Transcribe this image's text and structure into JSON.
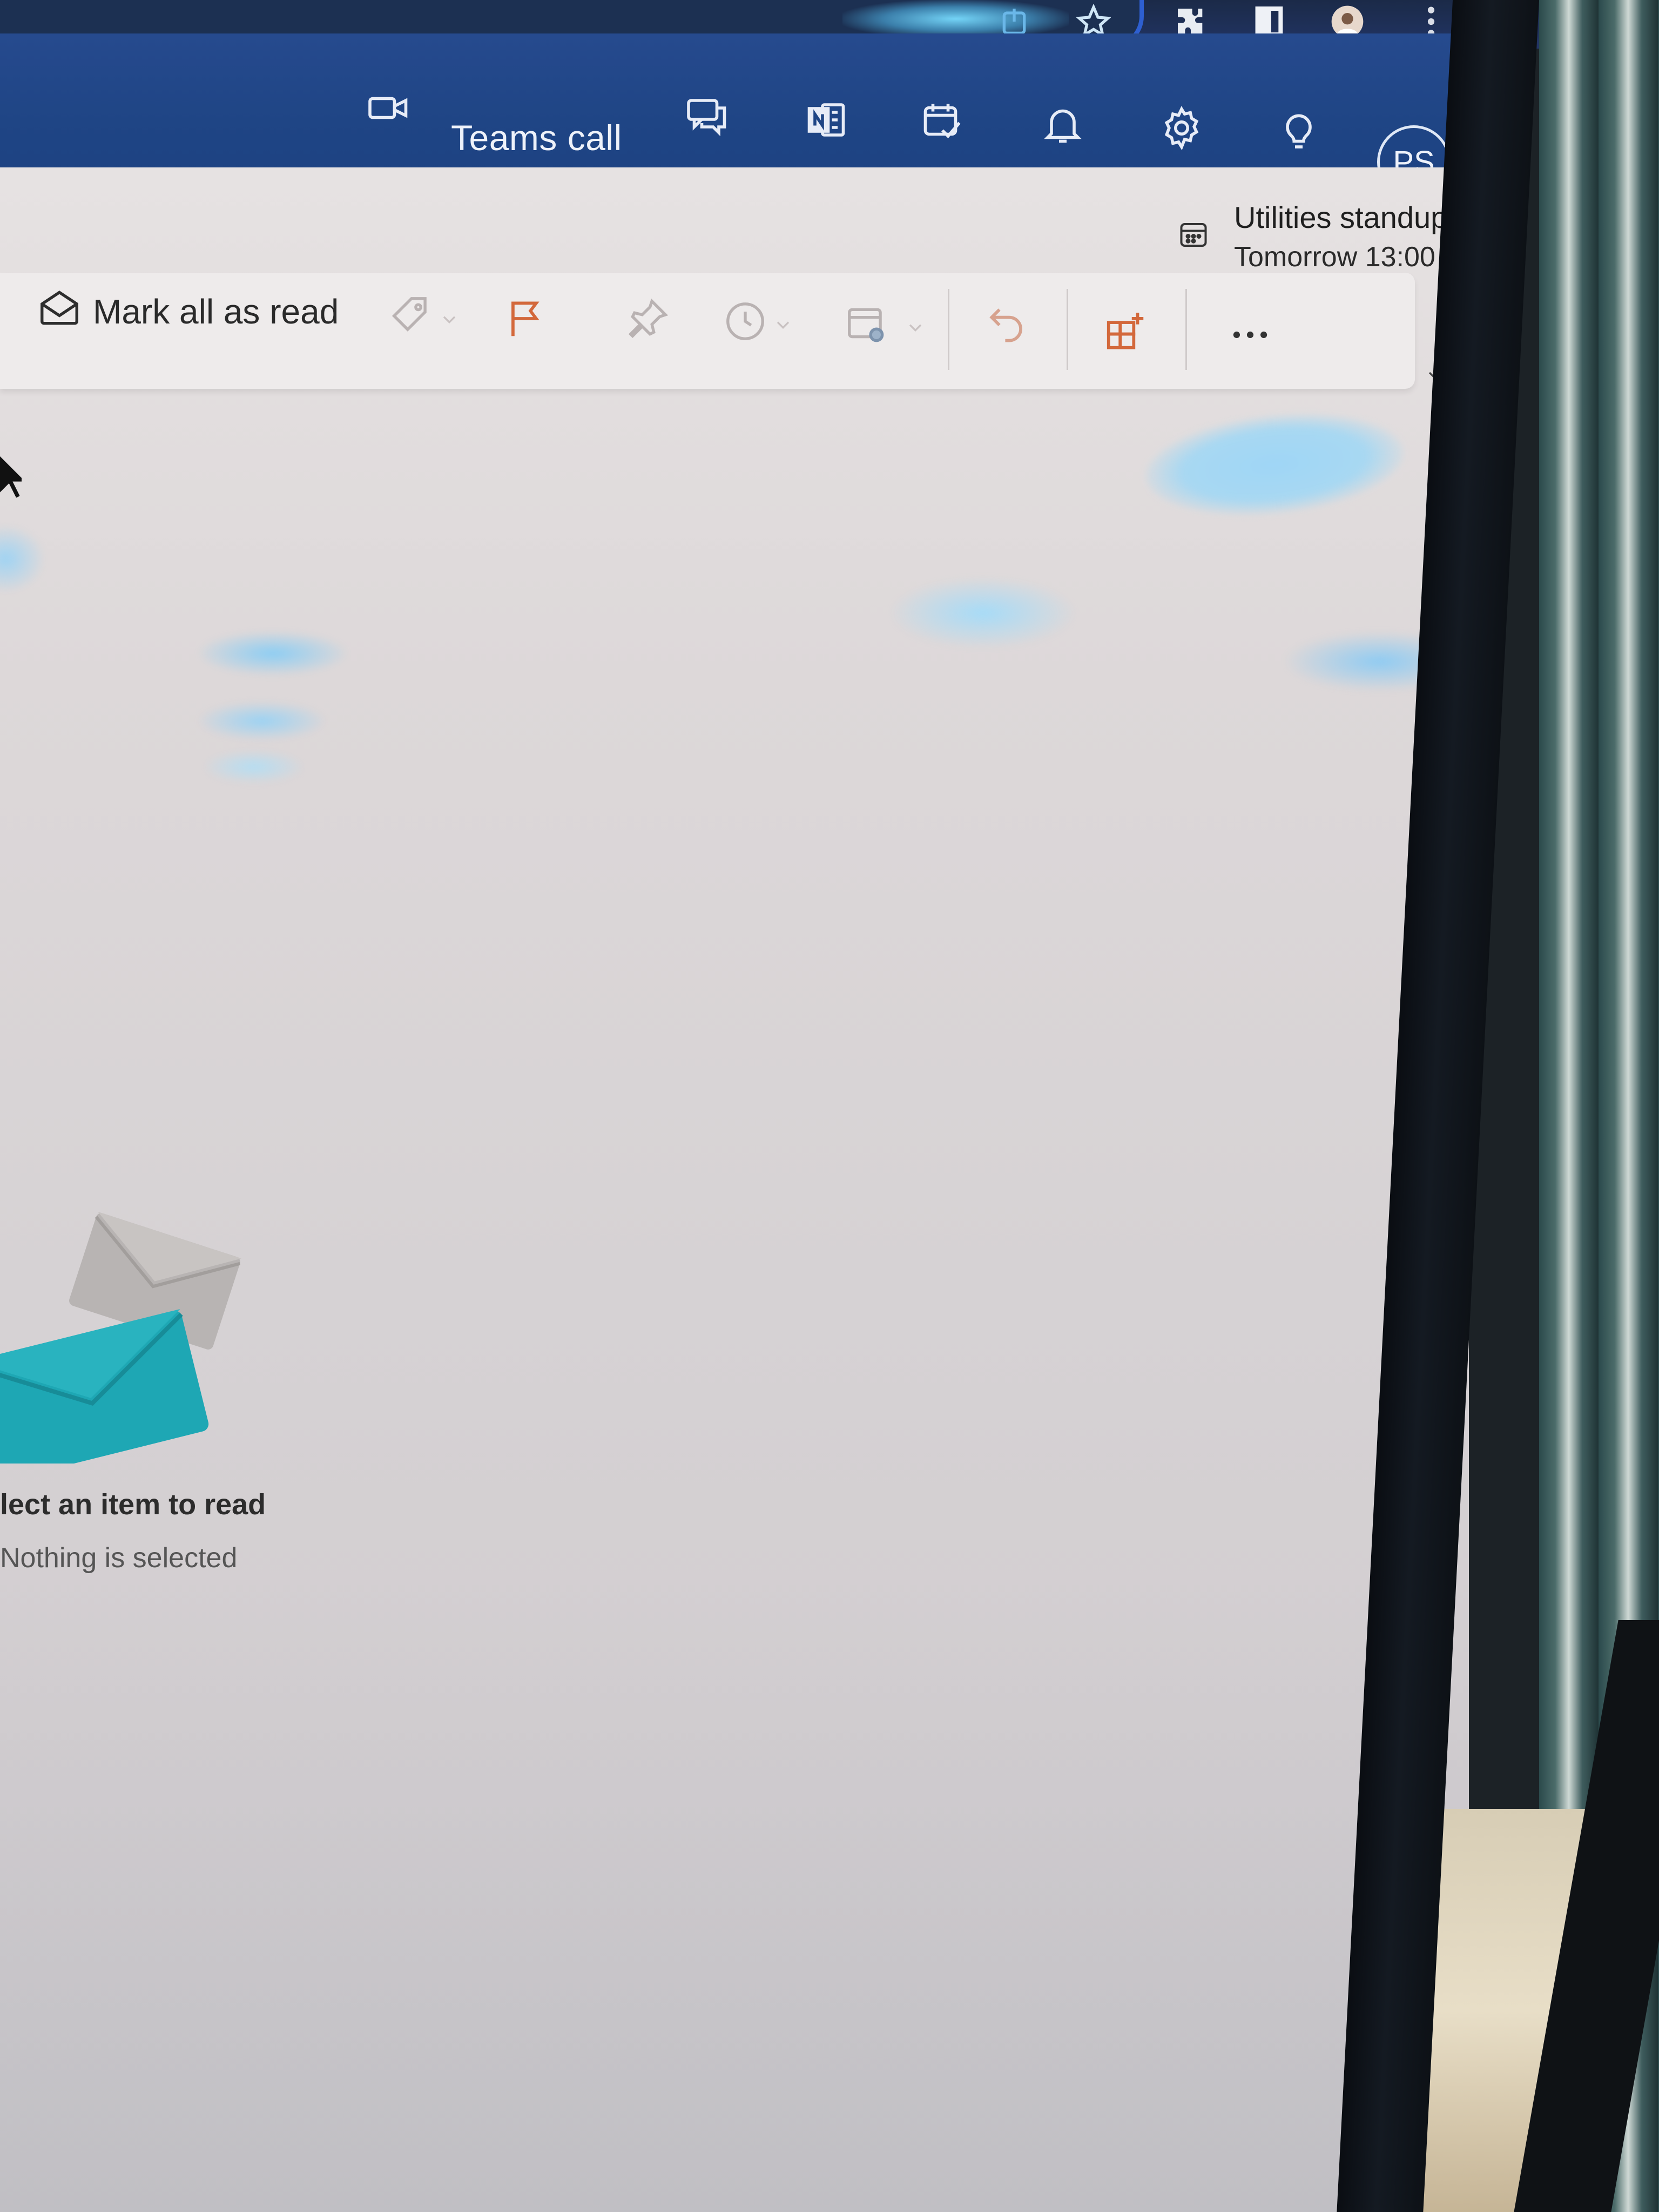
{
  "header": {
    "teams_call_label": "Teams call",
    "avatar_initials": "PS",
    "icons": [
      "video-camera-icon",
      "chat-icon",
      "onenote-icon",
      "calendar-check-icon",
      "bell-icon",
      "gear-icon",
      "lightbulb-icon"
    ]
  },
  "browser": {
    "icons": [
      "share-icon",
      "star-icon",
      "extensions-icon",
      "sidebar-icon",
      "profile-icon",
      "more-vertical-icon"
    ]
  },
  "event": {
    "title": "Utilities standup",
    "time": "Tomorrow 13:00"
  },
  "commandbar": {
    "mark_all_read_label": "Mark all as read",
    "more_label": "..."
  },
  "reading_pane": {
    "title": "lect an item to read",
    "subtitle": "Nothing is selected"
  },
  "colors": {
    "header_blue": "#1f4585",
    "accent_orange": "#d3683b",
    "envelope_teal": "#1ea7b4"
  }
}
